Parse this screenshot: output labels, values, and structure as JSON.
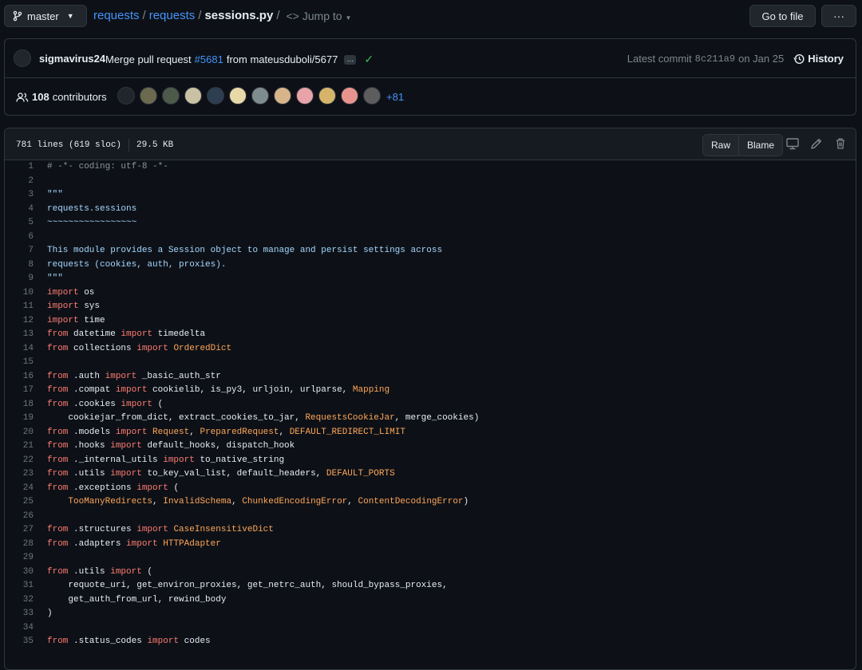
{
  "topbar": {
    "branch": "master",
    "crumbs": [
      "requests",
      "requests"
    ],
    "file": "sessions.py",
    "jump": "Jump to",
    "goto_label": "Go to file",
    "more_label": "···"
  },
  "commit": {
    "author": "sigmavirus24",
    "message_prefix": "Merge pull request",
    "pr": "#5681",
    "message_suffix": "from mateusduboli/5677",
    "latest_label": "Latest commit",
    "sha": "8c211a9",
    "date": "on Jan 25",
    "history_label": "History"
  },
  "contributors": {
    "count": "108",
    "label": "contributors",
    "more": "+81"
  },
  "file": {
    "lines": "781 lines (619 sloc)",
    "size": "29.5 KB",
    "raw_label": "Raw",
    "blame_label": "Blame"
  },
  "code_lines": [
    {
      "n": "1",
      "t": "# -*- coding: utf-8 -*-"
    },
    {
      "n": "2",
      "t": ""
    },
    {
      "n": "3",
      "t": "\"\"\""
    },
    {
      "n": "4",
      "t": "requests.sessions"
    },
    {
      "n": "5",
      "t": "~~~~~~~~~~~~~~~~~"
    },
    {
      "n": "6",
      "t": ""
    },
    {
      "n": "7",
      "t": "This module provides a Session object to manage and persist settings across"
    },
    {
      "n": "8",
      "t": "requests (cookies, auth, proxies)."
    },
    {
      "n": "9",
      "t": "\"\"\""
    },
    {
      "n": "10",
      "t": "import os"
    },
    {
      "n": "11",
      "t": "import sys"
    },
    {
      "n": "12",
      "t": "import time"
    },
    {
      "n": "13",
      "t": "from datetime import timedelta"
    },
    {
      "n": "14",
      "t": "from collections import OrderedDict"
    },
    {
      "n": "15",
      "t": ""
    },
    {
      "n": "16",
      "t": "from .auth import _basic_auth_str"
    },
    {
      "n": "17",
      "t": "from .compat import cookielib, is_py3, urljoin, urlparse, Mapping"
    },
    {
      "n": "18",
      "t": "from .cookies import ("
    },
    {
      "n": "19",
      "t": "    cookiejar_from_dict, extract_cookies_to_jar, RequestsCookieJar, merge_cookies)"
    },
    {
      "n": "20",
      "t": "from .models import Request, PreparedRequest, DEFAULT_REDIRECT_LIMIT"
    },
    {
      "n": "21",
      "t": "from .hooks import default_hooks, dispatch_hook"
    },
    {
      "n": "22",
      "t": "from ._internal_utils import to_native_string"
    },
    {
      "n": "23",
      "t": "from .utils import to_key_val_list, default_headers, DEFAULT_PORTS"
    },
    {
      "n": "24",
      "t": "from .exceptions import ("
    },
    {
      "n": "25",
      "t": "    TooManyRedirects, InvalidSchema, ChunkedEncodingError, ContentDecodingError)"
    },
    {
      "n": "26",
      "t": ""
    },
    {
      "n": "27",
      "t": "from .structures import CaseInsensitiveDict"
    },
    {
      "n": "28",
      "t": "from .adapters import HTTPAdapter"
    },
    {
      "n": "29",
      "t": ""
    },
    {
      "n": "30",
      "t": "from .utils import ("
    },
    {
      "n": "31",
      "t": "    requote_uri, get_environ_proxies, get_netrc_auth, should_bypass_proxies,"
    },
    {
      "n": "32",
      "t": "    get_auth_from_url, rewind_body"
    },
    {
      "n": "33",
      "t": ")"
    },
    {
      "n": "34",
      "t": ""
    },
    {
      "n": "35",
      "t": "from .status_codes import codes"
    }
  ],
  "colors": {
    "keyword": "#ff7b72",
    "class": "#ffa657",
    "docstring": "#a5d6ff",
    "link": "#4493f8"
  },
  "icons": [
    "branch-icon",
    "code-icon",
    "check-icon",
    "history-icon",
    "people-icon",
    "desktop-icon",
    "pencil-icon",
    "trash-icon"
  ]
}
